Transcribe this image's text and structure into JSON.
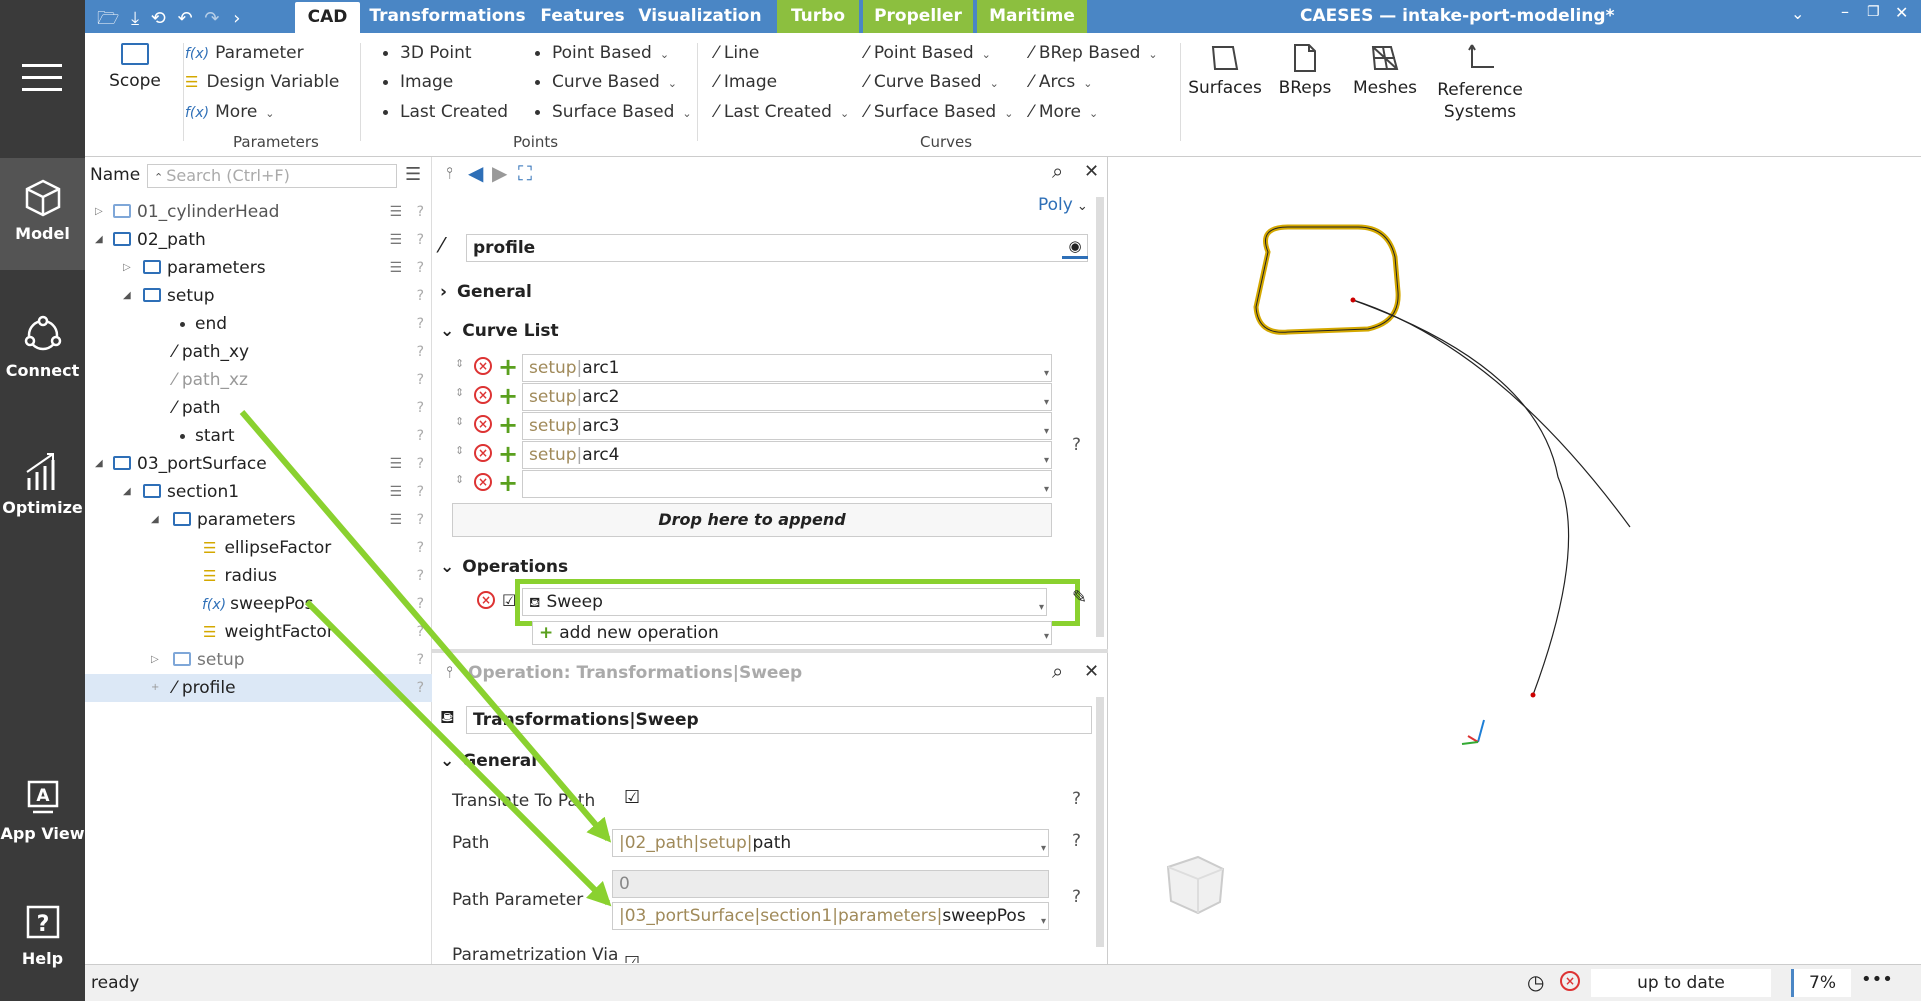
{
  "app": {
    "title": "CAESES — intake-port-modeling*"
  },
  "sidebar": {
    "items": [
      {
        "label": "Model",
        "icon": "cube-icon"
      },
      {
        "label": "Connect",
        "icon": "connect-icon"
      },
      {
        "label": "Optimize",
        "icon": "chart-icon"
      },
      {
        "label": "App View",
        "icon": "app-view-icon"
      },
      {
        "label": "Help",
        "icon": "help-icon"
      }
    ]
  },
  "tabs": [
    "CAD",
    "Transformations",
    "Features",
    "Visualization",
    "Turbo",
    "Propeller",
    "Maritime"
  ],
  "ribbon": {
    "scope": "Scope",
    "parameters": {
      "items": [
        "Parameter",
        "Design Variable",
        "More"
      ],
      "group": "Parameters"
    },
    "points": {
      "col1": [
        "3D Point",
        "Image",
        "Last Created"
      ],
      "col2": [
        "Point Based",
        "Curve Based",
        "Surface Based"
      ],
      "group": "Points"
    },
    "curves": {
      "col1": [
        "Line",
        "Image",
        "Last Created"
      ],
      "col2": [
        "Point Based",
        "Curve Based",
        "Surface Based"
      ],
      "col3": [
        "BRep Based",
        "Arcs",
        "More"
      ],
      "group": "Curves"
    },
    "big": [
      "Surfaces",
      "BReps",
      "Meshes",
      "Reference Systems"
    ]
  },
  "tree": {
    "name_label": "Name",
    "search_placeholder": "Search (Ctrl+F)",
    "rows": [
      "01_cylinderHead",
      "02_path",
      "parameters",
      "setup",
      "end",
      "path_xy",
      "path_xz",
      "path",
      "start",
      "03_portSurface",
      "section1",
      "parameters",
      "ellipseFactor",
      "radius",
      "sweepPos",
      "weightFactor",
      "setup",
      "profile"
    ]
  },
  "props": {
    "poly": "Poly",
    "name": "profile",
    "general": "General",
    "curve_list": "Curve List",
    "curves": [
      {
        "prefix": "setup",
        "name": "arc1"
      },
      {
        "prefix": "setup",
        "name": "arc2"
      },
      {
        "prefix": "setup",
        "name": "arc3"
      },
      {
        "prefix": "setup",
        "name": "arc4"
      }
    ],
    "drop_hint": "Drop here to append",
    "operations": "Operations",
    "operation": "Sweep",
    "add_op": "add new operation"
  },
  "op": {
    "header": "Operation: Transformations|Sweep",
    "name_prefix": "Transformations",
    "name": "Sweep",
    "general": "General",
    "translate_label": "Translate To Path",
    "path_label": "Path",
    "path_prefix": "|02_path|setup|",
    "path_value": "path",
    "param_label": "Path Parameter",
    "param_zero": "0",
    "param_prefix": "|03_portSurface|section1|parameters|",
    "param_value": "sweepPos",
    "param_via": "Parametrization Via"
  },
  "status": {
    "text": "ready",
    "update": "up to date",
    "zoom": "7%"
  },
  "colors": {
    "accent": "#4a86c5",
    "green": "#8cbf3f",
    "highlight": "#8ad12f",
    "curve": "#d4a800"
  }
}
